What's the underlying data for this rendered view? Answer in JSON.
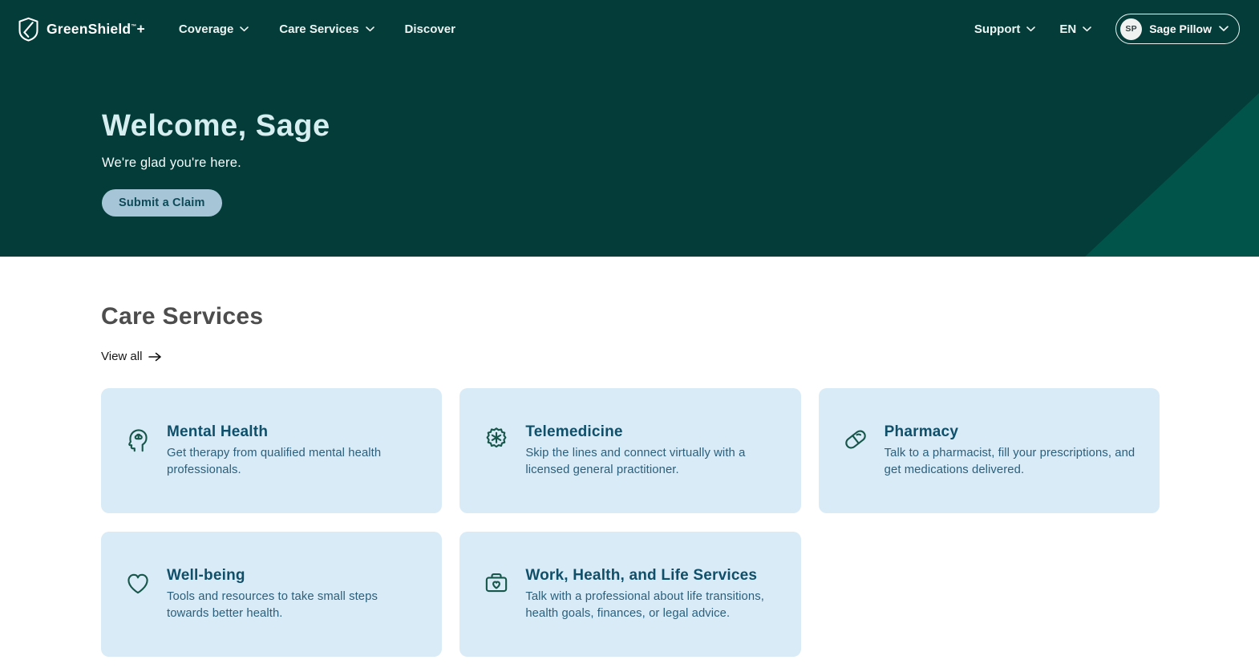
{
  "brand": {
    "name": "GreenShield",
    "tm": "™",
    "suffix": "+"
  },
  "header": {
    "nav": [
      {
        "label": "Coverage",
        "dropdown": true
      },
      {
        "label": "Care Services",
        "dropdown": true
      },
      {
        "label": "Discover",
        "dropdown": false
      }
    ],
    "support_label": "Support",
    "language": "EN",
    "user": {
      "initials": "SP",
      "name": "Sage Pillow"
    }
  },
  "hero": {
    "title": "Welcome, Sage",
    "subtitle": "We're glad you're here.",
    "cta_label": "Submit a Claim"
  },
  "care_services": {
    "title": "Care Services",
    "view_all_label": "View all",
    "cards": [
      {
        "icon": "mental-health-icon",
        "title": "Mental Health",
        "description": "Get therapy from qualified mental health professionals."
      },
      {
        "icon": "telemedicine-icon",
        "title": "Telemedicine",
        "description": "Skip the lines and connect virtually with a licensed general practitioner."
      },
      {
        "icon": "pharmacy-icon",
        "title": "Pharmacy",
        "description": "Talk to a pharmacist, fill your prescriptions, and get medications delivered."
      },
      {
        "icon": "well-being-icon",
        "title": "Well-being",
        "description": "Tools and resources to take small steps towards better health."
      },
      {
        "icon": "work-health-life-icon",
        "title": "Work, Health, and Life Services",
        "description": "Talk with a professional about life transitions, health goals, finances, or legal advice."
      }
    ]
  },
  "colors": {
    "header_bg": "#033C38",
    "hero_accent_triangle": "#00544A",
    "hero_title": "#D7EEF1",
    "cta_bg": "#A6C5D6",
    "cta_text": "#0D4A58",
    "card_bg": "#D8EBF7",
    "card_title": "#0F4F6A",
    "card_text": "#2B5F7B",
    "icon_stroke": "#17564A",
    "section_title": "#4D4D4D"
  }
}
